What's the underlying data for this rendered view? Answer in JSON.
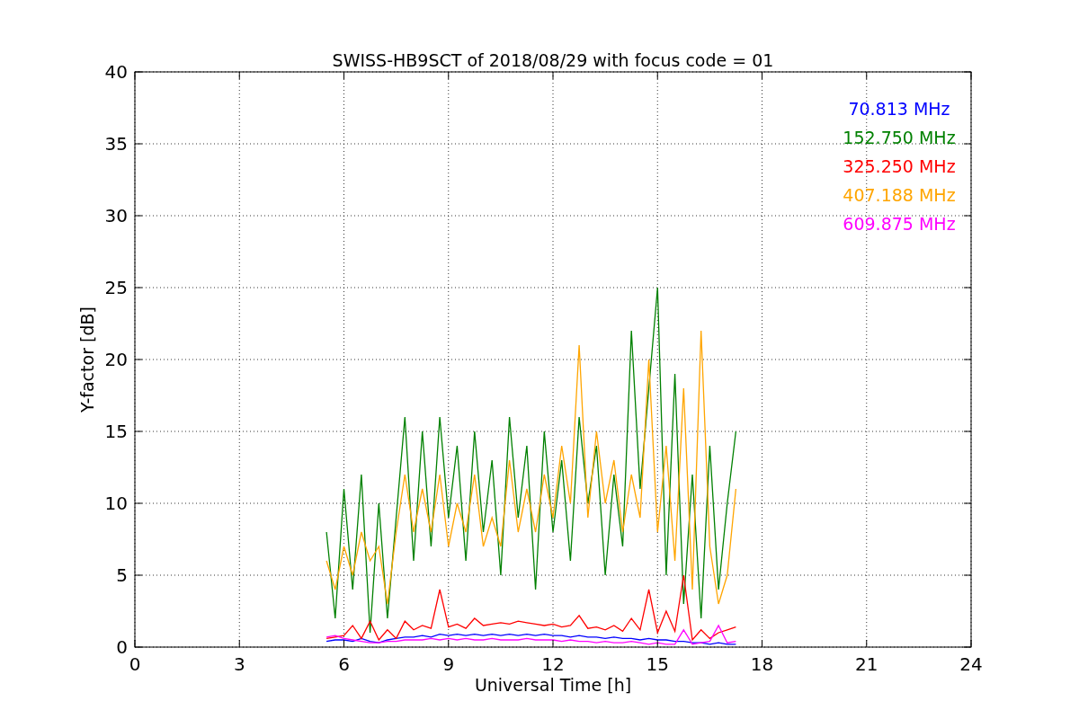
{
  "chart_data": {
    "type": "line",
    "title": "SWISS-HB9SCT of 2018/08/29 with focus code = 01",
    "xlabel": "Universal Time [h]",
    "ylabel": "Y-factor [dB]",
    "x": [
      5.5,
      5.75,
      6,
      6.25,
      6.5,
      6.75,
      7,
      7.25,
      7.5,
      7.75,
      8,
      8.25,
      8.5,
      8.75,
      9,
      9.25,
      9.5,
      9.75,
      10,
      10.25,
      10.5,
      10.75,
      11,
      11.25,
      11.5,
      11.75,
      12,
      12.25,
      12.5,
      12.75,
      13,
      13.25,
      13.5,
      13.75,
      14,
      14.25,
      14.5,
      14.75,
      15,
      15.25,
      15.5,
      15.75,
      16,
      16.25,
      16.5,
      16.75,
      17,
      17.25
    ],
    "series": [
      {
        "name": "70.813 MHz",
        "color": "#0000ff",
        "values": [
          0.4,
          0.5,
          0.5,
          0.4,
          0.6,
          0.4,
          0.3,
          0.5,
          0.6,
          0.7,
          0.7,
          0.8,
          0.7,
          0.9,
          0.8,
          0.9,
          0.8,
          0.9,
          0.8,
          0.9,
          0.8,
          0.9,
          0.8,
          0.9,
          0.8,
          0.9,
          0.8,
          0.8,
          0.7,
          0.8,
          0.7,
          0.7,
          0.6,
          0.7,
          0.6,
          0.6,
          0.5,
          0.6,
          0.5,
          0.5,
          0.4,
          0.4,
          0.3,
          0.3,
          0.2,
          0.3,
          0.2,
          0.2
        ]
      },
      {
        "name": "152.750 MHz",
        "color": "#008000",
        "values": [
          8,
          2,
          11,
          4,
          12,
          1,
          10,
          2,
          9,
          16,
          6,
          15,
          7,
          16,
          9,
          14,
          6,
          15,
          8,
          13,
          5,
          16,
          9,
          14,
          4,
          15,
          8,
          13,
          6,
          16,
          10,
          14,
          5,
          12,
          7,
          22,
          11,
          18,
          25,
          5,
          19,
          3,
          12,
          2,
          14,
          4,
          10,
          15
        ]
      },
      {
        "name": "325.250 MHz",
        "color": "#ff0000",
        "values": [
          0.6,
          0.7,
          0.8,
          1.5,
          0.6,
          1.8,
          0.5,
          1.2,
          0.6,
          1.8,
          1.2,
          1.5,
          1.3,
          4,
          1.4,
          1.6,
          1.3,
          2,
          1.5,
          1.6,
          1.7,
          1.6,
          1.8,
          1.7,
          1.6,
          1.5,
          1.6,
          1.4,
          1.5,
          2.2,
          1.3,
          1.4,
          1.2,
          1.5,
          1.1,
          2,
          1.2,
          4,
          1,
          2.5,
          1.1,
          5,
          0.5,
          1.2,
          0.6,
          1,
          1.2,
          1.4
        ]
      },
      {
        "name": "407.188 MHz",
        "color": "#ffa500",
        "values": [
          6,
          4,
          7,
          5,
          8,
          6,
          7,
          3,
          8,
          12,
          8,
          11,
          8,
          12,
          7,
          10,
          8,
          12,
          7,
          9,
          7,
          13,
          8,
          11,
          8,
          12,
          9,
          14,
          10,
          21,
          9,
          15,
          10,
          13,
          8,
          12,
          9,
          20,
          8,
          14,
          6,
          18,
          4,
          22,
          7,
          3,
          5,
          11
        ]
      },
      {
        "name": "609.875 MHz",
        "color": "#ff00ff",
        "values": [
          0.7,
          0.8,
          0.6,
          0.5,
          0.4,
          0.3,
          0.3,
          0.4,
          0.4,
          0.5,
          0.5,
          0.5,
          0.6,
          0.5,
          0.6,
          0.5,
          0.6,
          0.5,
          0.5,
          0.6,
          0.5,
          0.5,
          0.5,
          0.6,
          0.5,
          0.5,
          0.5,
          0.4,
          0.5,
          0.4,
          0.4,
          0.3,
          0.4,
          0.3,
          0.3,
          0.4,
          0.3,
          0.2,
          0.3,
          0.2,
          0.2,
          1.2,
          0.2,
          0.3,
          0.4,
          1.5,
          0.3,
          0.4
        ]
      }
    ],
    "xlim": [
      0,
      24
    ],
    "ylim": [
      0,
      40
    ],
    "xticks": [
      0,
      3,
      6,
      9,
      12,
      15,
      18,
      21,
      24
    ],
    "yticks": [
      0,
      5,
      10,
      15,
      20,
      25,
      30,
      35,
      40
    ],
    "grid": true
  }
}
